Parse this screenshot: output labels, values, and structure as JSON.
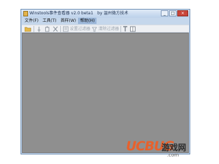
{
  "window": {
    "title": "Winstools事件查看器 v2.0 beta1",
    "title_suffix": "by 温州微方技术",
    "buttons": [
      "_",
      "□",
      "×"
    ]
  },
  "menubar": {
    "items": [
      {
        "label": "文件(F)"
      },
      {
        "label": "工具(T)"
      },
      {
        "label": "首样(W)"
      },
      {
        "label": "帮助(H)"
      }
    ]
  },
  "toolbar": {
    "set_filter": "设置过滤器",
    "clear_filter": "清除过滤器"
  },
  "watermark": {
    "brand": "UCBUG",
    "cn": "游戏网",
    "domain": ".com"
  },
  "colors": {
    "accent": "#e8612c",
    "content_bg": "#8f8f8f",
    "titlebar": "#c5d7ec"
  }
}
